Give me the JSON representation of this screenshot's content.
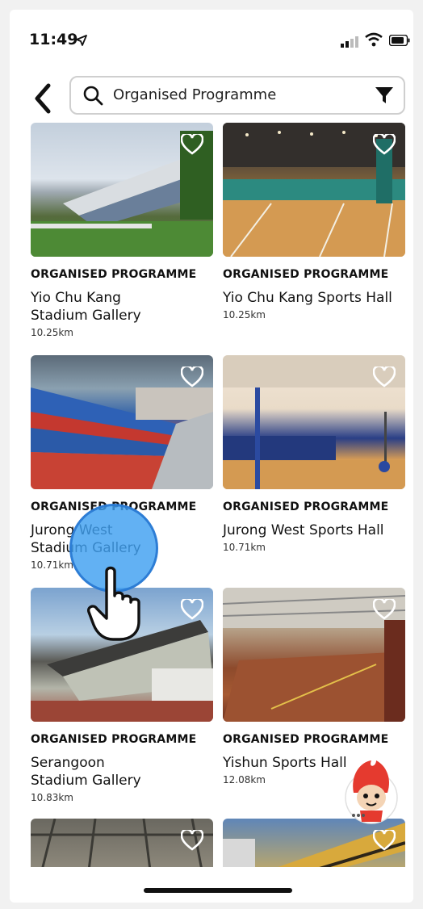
{
  "status_bar": {
    "time": "11:49"
  },
  "search": {
    "query": "Organised Programme"
  },
  "facilities": [
    {
      "category": "ORGANISED PROGRAMME",
      "name_line1": "Yio Chu Kang",
      "name_line2": "Stadium Gallery",
      "distance": "10.25km"
    },
    {
      "category": "ORGANISED PROGRAMME",
      "name_line1": "Yio Chu Kang Sports Hall",
      "name_line2": "",
      "distance": "10.25km"
    },
    {
      "category": "ORGANISED PROGRAMME",
      "name_line1": "Jurong West",
      "name_line2": "Stadium Gallery",
      "distance": "10.71km"
    },
    {
      "category": "ORGANISED PROGRAMME",
      "name_line1": "Jurong West Sports Hall",
      "name_line2": "",
      "distance": "10.71km"
    },
    {
      "category": "ORGANISED PROGRAMME",
      "name_line1": "Serangoon",
      "name_line2": "Stadium Gallery",
      "distance": "10.83km"
    },
    {
      "category": "ORGANISED PROGRAMME",
      "name_line1": "Yishun Sports Hall",
      "name_line2": "",
      "distance": "12.08km"
    }
  ],
  "colors": {
    "accent_blue": "#3fa0ee",
    "mascot_red": "#e53a2f",
    "text": "#111111"
  },
  "icons": [
    "location-arrow-icon",
    "signal-icon",
    "wifi-icon",
    "battery-icon",
    "back-chevron-icon",
    "search-icon",
    "filter-icon",
    "heart-icon",
    "tap-hand-icon",
    "mascot-chat-icon"
  ]
}
